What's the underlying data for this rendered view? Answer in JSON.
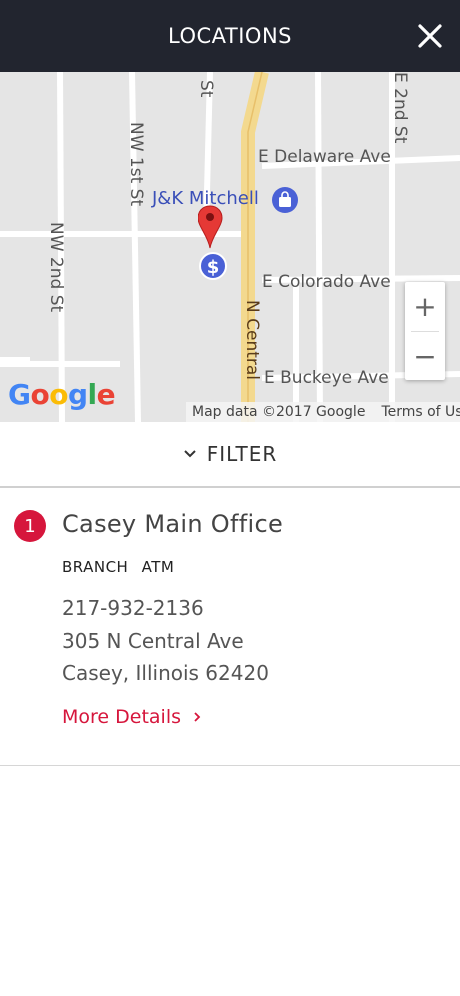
{
  "header": {
    "title": "LOCATIONS"
  },
  "map": {
    "streets": {
      "e_delaware": "E Delaware Ave",
      "e_colorado": "E Colorado Ave",
      "e_buckeye": "E Buckeye Ave",
      "n_central": "N Central",
      "nw_1st": "NW 1st St",
      "nw_2nd": "NW 2nd St",
      "e_2nd": "E 2nd St",
      "top_st": "St"
    },
    "poi": {
      "name": "J&K Mitchell"
    },
    "zoom": {
      "in": "+",
      "out": "−"
    },
    "google_logo": [
      "G",
      "o",
      "o",
      "g",
      "l",
      "e"
    ],
    "google_colors": [
      "#4285f4",
      "#ea4335",
      "#fbbc05",
      "#4285f4",
      "#34a853",
      "#ea4335"
    ],
    "footer": {
      "map_data": "Map data ©2017 Google",
      "terms": "Terms of Use"
    }
  },
  "filter": {
    "label": "FILTER"
  },
  "locations": [
    {
      "number": "1",
      "name": "Casey Main Office",
      "types": [
        "BRANCH",
        "ATM"
      ],
      "phone": "217-932-2136",
      "address_line1": "305 N Central Ave",
      "address_line2": "Casey, Illinois 62420",
      "more_label": "More Details"
    }
  ],
  "colors": {
    "header_bg": "#22252f",
    "accent": "#d6163c",
    "poi": "#3a4fb8"
  }
}
